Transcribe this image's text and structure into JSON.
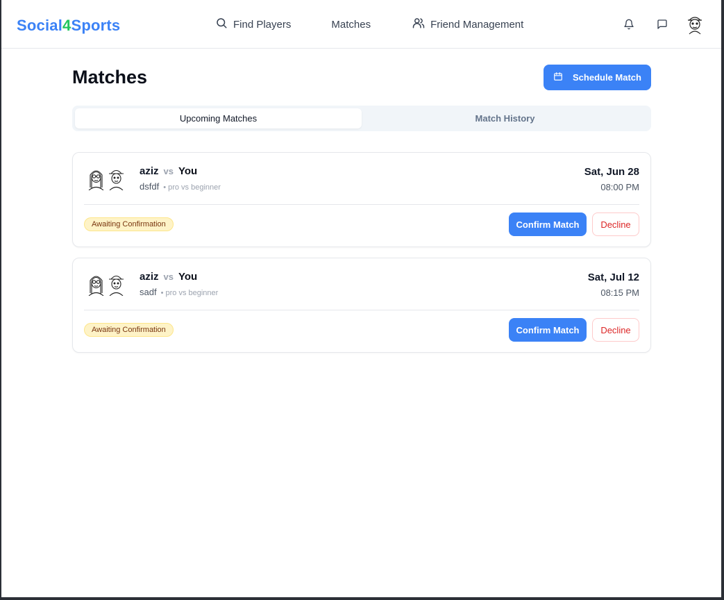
{
  "brand": {
    "prefix": "Social",
    "number": "4",
    "suffix": "Sports"
  },
  "nav": {
    "find_players": "Find Players",
    "matches": "Matches",
    "friend_management": "Friend Management"
  },
  "page": {
    "title": "Matches",
    "schedule_label": "Schedule Match"
  },
  "tabs": [
    {
      "label": "Upcoming Matches",
      "active": true
    },
    {
      "label": "Match History",
      "active": false
    }
  ],
  "matches": [
    {
      "player1": "aziz",
      "vs": "vs",
      "player2": "You",
      "note": "dsfdf",
      "level": "• pro vs beginner",
      "date": "Sat, Jun 28",
      "time": "08:00 PM",
      "status": "Awaiting Confirmation",
      "confirm_label": "Confirm Match",
      "decline_label": "Decline"
    },
    {
      "player1": "aziz",
      "vs": "vs",
      "player2": "You",
      "note": "sadf",
      "level": "• pro vs beginner",
      "date": "Sat, Jul 12",
      "time": "08:15 PM",
      "status": "Awaiting Confirmation",
      "confirm_label": "Confirm Match",
      "decline_label": "Decline"
    }
  ],
  "icons": {
    "find_players": "search-icon",
    "friend_management": "users-icon",
    "notifications": "bell-icon",
    "messages": "chat-icon",
    "schedule": "calendar-icon"
  },
  "colors": {
    "primary": "#3b82f6",
    "brand_accent": "#22c55e",
    "badge_bg": "#fef3c7",
    "decline": "#dc2626"
  }
}
